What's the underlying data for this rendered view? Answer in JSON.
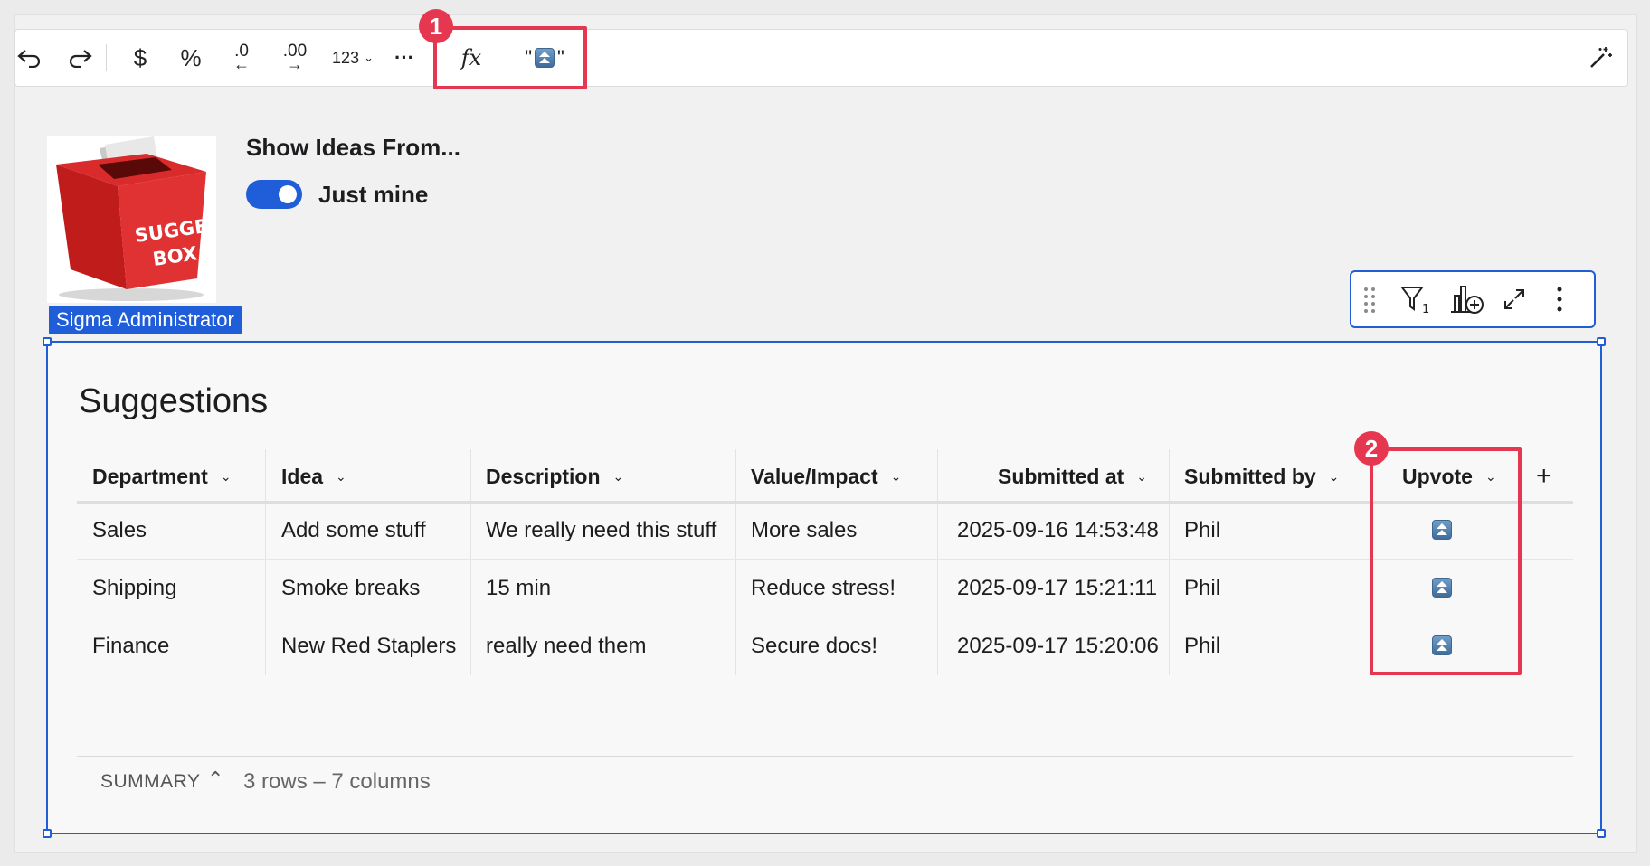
{
  "toolbar": {
    "undo_icon": "undo-icon",
    "redo_icon": "redo-icon",
    "currency_label": "$",
    "percent_label": "%",
    "decrease_decimals_label": ".0",
    "increase_decimals_label": ".00",
    "number_format_label": "123",
    "more_label": "···",
    "formula_label": "fx",
    "formula_quote_open": "\"",
    "formula_quote_close": "\""
  },
  "annotations": [
    "1",
    "2"
  ],
  "control": {
    "title": "Show Ideas From...",
    "toggle_label": "Just mine",
    "toggle_on": true
  },
  "image": {
    "logo_text_line1": "SUGGESTION",
    "logo_text_line2": "BOX",
    "user_tag": "Sigma Administrator"
  },
  "table": {
    "title": "Suggestions",
    "columns": [
      "Department",
      "Idea",
      "Description",
      "Value/Impact",
      "Submitted at",
      "Submitted by",
      "Upvote"
    ],
    "add_column_label": "+",
    "rows": [
      {
        "department": "Sales",
        "idea": "Add some stuff",
        "description": "We really need this stuff",
        "value": "More sales",
        "submitted_at": "2025-09-16 14:53:48",
        "submitted_by": "Phil"
      },
      {
        "department": "Shipping",
        "idea": "Smoke breaks",
        "description": "15 min",
        "value": "Reduce stress!",
        "submitted_at": "2025-09-17 15:21:11",
        "submitted_by": "Phil"
      },
      {
        "department": "Finance",
        "idea": "New Red Staplers",
        "description": "really need them",
        "value": "Secure docs!",
        "submitted_at": "2025-09-17 15:20:06",
        "submitted_by": "Phil"
      }
    ],
    "summary_label": "SUMMARY",
    "summary_text": "3 rows – 7 columns"
  },
  "colors": {
    "accent": "#1f5ed8",
    "annotation": "#e5374f"
  }
}
